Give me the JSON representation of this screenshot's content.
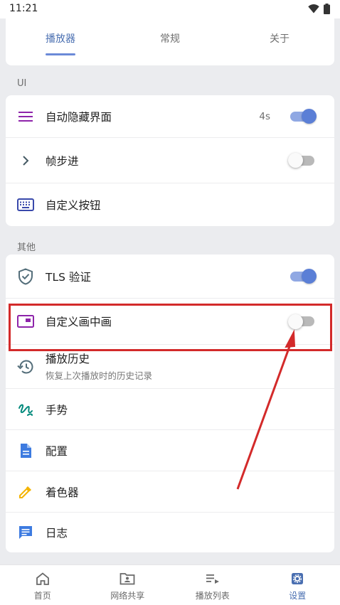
{
  "status_bar": {
    "time": "11:21",
    "icons": [
      "wifi-icon",
      "battery-icon"
    ]
  },
  "tabs": [
    {
      "label": "播放器",
      "active": true
    },
    {
      "label": "常规",
      "active": false
    },
    {
      "label": "关于",
      "active": false
    }
  ],
  "sections": {
    "ui": {
      "title": "UI",
      "items": [
        {
          "label": "自动隐藏界面",
          "value": "4s",
          "icon": "menu-icon",
          "toggle": true
        },
        {
          "label": "帧步进",
          "icon": "chevron-right-icon",
          "toggle": false
        },
        {
          "label": "自定义按钮",
          "icon": "keyboard-icon"
        }
      ]
    },
    "other": {
      "title": "其他",
      "items": [
        {
          "label": "TLS 验证",
          "icon": "shield-check-icon",
          "toggle": true
        },
        {
          "label": "自定义画中画",
          "icon": "picture-in-picture-icon",
          "toggle": false
        },
        {
          "label": "播放历史",
          "subtitle": "恢复上次播放时的历史记录",
          "icon": "history-icon"
        },
        {
          "label": "手势",
          "icon": "gesture-icon"
        },
        {
          "label": "配置",
          "icon": "document-icon"
        },
        {
          "label": "着色器",
          "icon": "eyedropper-icon"
        },
        {
          "label": "日志",
          "icon": "message-icon"
        }
      ]
    }
  },
  "bottom_nav": [
    {
      "label": "首页",
      "icon": "home-icon",
      "active": false
    },
    {
      "label": "网络共享",
      "icon": "shared-folder-icon",
      "active": false
    },
    {
      "label": "播放列表",
      "icon": "playlist-icon",
      "active": false
    },
    {
      "label": "设置",
      "icon": "settings-icon",
      "active": true
    }
  ],
  "colors": {
    "accent": "#5b7fd6",
    "tab_active": "#4a6fb1",
    "annotation_red": "#d32a2a",
    "menu_icon": "#8e24aa",
    "pip_icon": "#8e24aa",
    "gesture_icon": "#00897b",
    "config_icon": "#3d7be0",
    "shader_icon": "#f4b400",
    "log_icon": "#3d7be0"
  }
}
